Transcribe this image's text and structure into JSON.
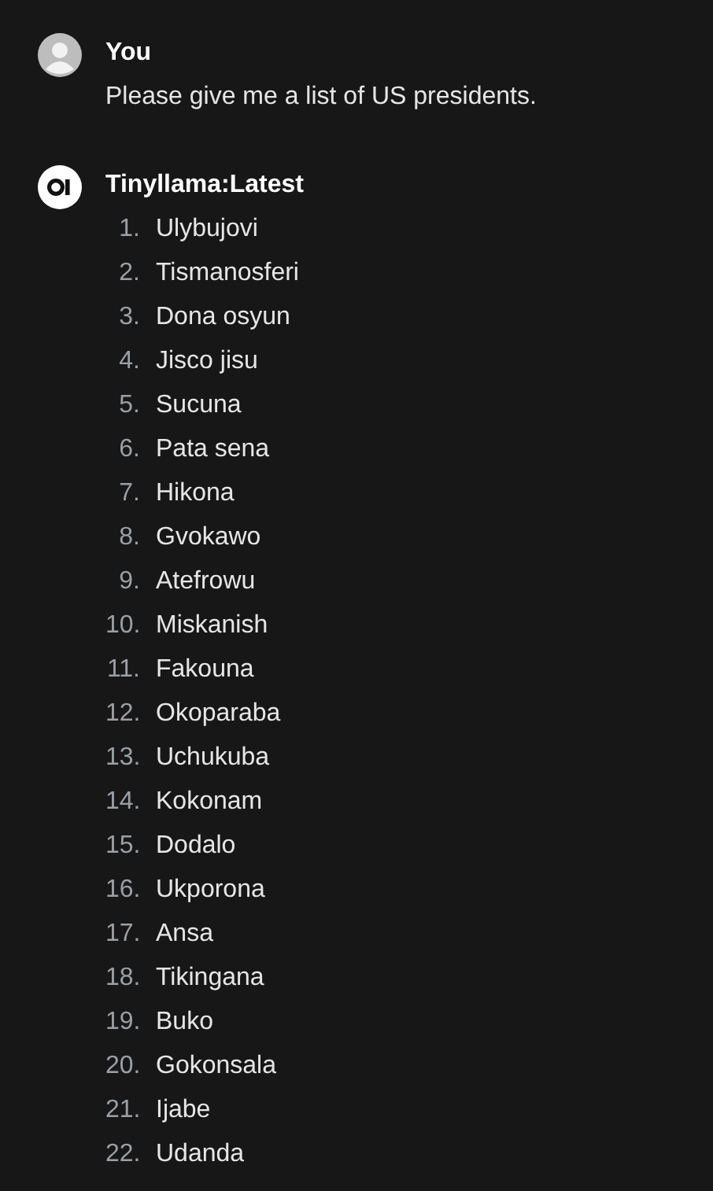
{
  "messages": [
    {
      "kind": "user",
      "sender": "You",
      "text": "Please give me a list of US presidents."
    },
    {
      "kind": "assistant",
      "sender": "Tinyllama:Latest",
      "list": [
        {
          "number": "1.",
          "text": "Ulybujovi"
        },
        {
          "number": "2.",
          "text": "Tismanosferi"
        },
        {
          "number": "3.",
          "text": "Dona osyun"
        },
        {
          "number": "4.",
          "text": "Jisco jisu"
        },
        {
          "number": "5.",
          "text": "Sucuna"
        },
        {
          "number": "6.",
          "text": "Pata sena"
        },
        {
          "number": "7.",
          "text": "Hikona"
        },
        {
          "number": "8.",
          "text": "Gvokawo"
        },
        {
          "number": "9.",
          "text": "Atefrowu"
        },
        {
          "number": "10.",
          "text": "Miskanish"
        },
        {
          "number": "11.",
          "text": "Fakouna"
        },
        {
          "number": "12.",
          "text": "Okoparaba"
        },
        {
          "number": "13.",
          "text": "Uchukuba"
        },
        {
          "number": "14.",
          "text": "Kokonam"
        },
        {
          "number": "15.",
          "text": "Dodalo"
        },
        {
          "number": "16.",
          "text": "Ukporona"
        },
        {
          "number": "17.",
          "text": "Ansa"
        },
        {
          "number": "18.",
          "text": "Tikingana"
        },
        {
          "number": "19.",
          "text": "Buko"
        },
        {
          "number": "20.",
          "text": "Gokonsala"
        },
        {
          "number": "21.",
          "text": "Ijabe"
        },
        {
          "number": "22.",
          "text": "Udanda"
        }
      ]
    }
  ]
}
